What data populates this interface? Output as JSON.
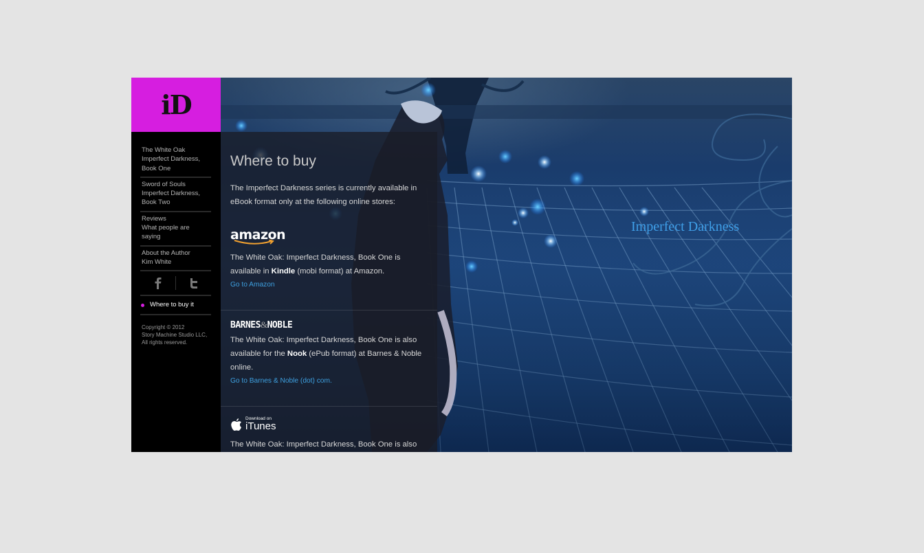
{
  "logo": {
    "text": "iD"
  },
  "sidebar": {
    "items": [
      {
        "line1": "The White Oak",
        "line2": "Imperfect Darkness,",
        "line3": "Book One"
      },
      {
        "line1": "Sword of Souls",
        "line2": "Imperfect Darkness,",
        "line3": "Book Two"
      },
      {
        "line1": "Reviews",
        "line2": "What people are saying"
      },
      {
        "line1": "About the Author",
        "line2": "Kim White"
      }
    ],
    "social": {
      "facebook": "f",
      "twitter": "t"
    },
    "active_item": "Where to buy it",
    "copyright": [
      "Copyright © 2012",
      "Story Machine Studio LLC,",
      "All rights reserved."
    ]
  },
  "content": {
    "title": "Where to buy",
    "intro": "The Imperfect Darkness series is currently available in eBook format only at the following online stores:",
    "stores": {
      "amazon": {
        "logo": "amazon",
        "desc_pre": "The White Oak: Imperfect Darkness, Book One is available in ",
        "desc_bold": "Kindle",
        "desc_post": " (mobi format) at Amazon.",
        "link": "Go to Amazon"
      },
      "bn": {
        "logo_a": "BARNES",
        "logo_amp": "&",
        "logo_b": "NOBLE",
        "desc_pre": "The White Oak: Imperfect Darkness, Book One is also available for the ",
        "desc_bold": "Nook",
        "desc_post": " (ePub format) at Barnes & Noble online.",
        "link": "Go to Barnes & Noble (dot) com."
      },
      "itunes": {
        "logo_small": "Download on",
        "logo_big": "iTunes",
        "desc": "The White Oak: Imperfect Darkness, Book One is also"
      }
    }
  },
  "brand_title": "Imperfect Darkness",
  "colors": {
    "accent": "#d61ee0",
    "link": "#3ea0e0",
    "brand": "#3f9fe8"
  }
}
